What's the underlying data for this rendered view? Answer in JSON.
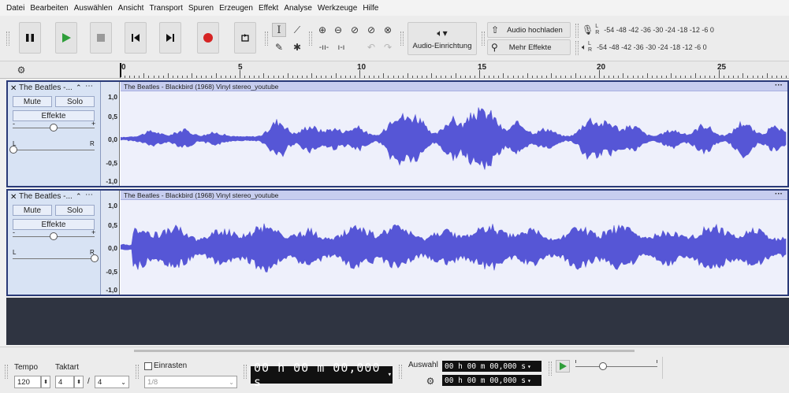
{
  "menu": [
    "Datei",
    "Bearbeiten",
    "Auswählen",
    "Ansicht",
    "Transport",
    "Spuren",
    "Erzeugen",
    "Effekt",
    "Analyse",
    "Werkzeuge",
    "Hilfe"
  ],
  "toolbar": {
    "audio_setup_label": "Audio-Einrichtung",
    "share_audio_label": "Audio hochladen",
    "more_effects_label": "Mehr Effekte",
    "record_meter": {
      "L": "L",
      "R": "R",
      "scale": "-54 -48 -42 -36 -30 -24 -18 -12 -6 0"
    },
    "play_meter": {
      "L": "L",
      "R": "R",
      "scale": "-54 -48 -42 -36 -30 -24 -18 -12 -6 0"
    }
  },
  "ruler": {
    "labels": [
      "0",
      "5",
      "10",
      "15",
      "20",
      "25"
    ]
  },
  "tracks": [
    {
      "name": "The Beatles -...",
      "mute_label": "Mute",
      "solo_label": "Solo",
      "effects_label": "Effekte",
      "pan_left": "L",
      "pan_right": "R",
      "scale": [
        "1,0",
        "0,5",
        "0,0",
        "-0,5",
        "-1,0"
      ],
      "clip_title": "The Beatles - Blackbird (1968) Vinyl stereo_youtube"
    },
    {
      "name": "The Beatles -...",
      "mute_label": "Mute",
      "solo_label": "Solo",
      "effects_label": "Effekte",
      "pan_left": "L",
      "pan_right": "R",
      "scale": [
        "1,0",
        "0,5",
        "0,0",
        "-0,5",
        "-1,0"
      ],
      "clip_title": "The Beatles - Blackbird (1968) Vinyl stereo_youtube"
    }
  ],
  "bottom": {
    "tempo_label": "Tempo",
    "tempo_value": "120",
    "time_sig_label": "Taktart",
    "time_sig_num": "4",
    "time_sig_slash": "/",
    "time_sig_den": "4",
    "snap_label": "Einrasten",
    "snap_value": "1/8",
    "main_time": "00 h 00 m 00,000 s",
    "selection_label": "Auswahl",
    "sel_start": "00 h 00 m 00,000 s",
    "sel_end": "00 h 00 m 00,000 s"
  },
  "colors": {
    "waveform": "#5656d6",
    "clip_bar": "#c7cdef",
    "track_ctl": "#d8e3f4",
    "record": "#d62424",
    "play": "#2f9e3a",
    "empty_area": "#2f3441"
  }
}
